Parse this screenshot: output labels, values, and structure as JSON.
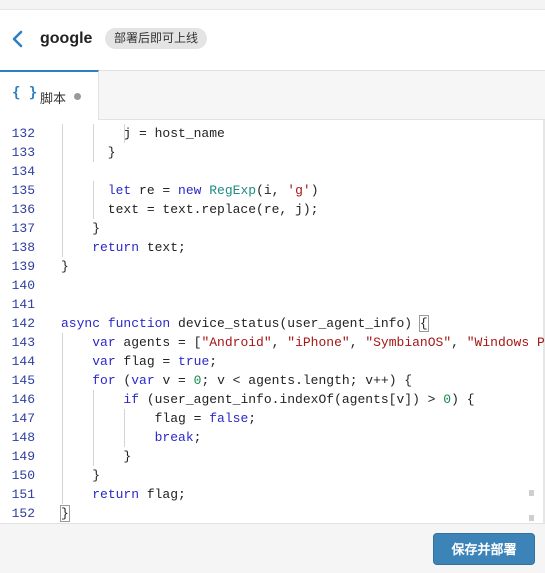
{
  "header": {
    "title": "google",
    "badge": "部署后即可上线"
  },
  "tabs": [
    {
      "icon": "{ }",
      "label": "脚本",
      "unsaved": true
    }
  ],
  "editor": {
    "lines": [
      {
        "num": "132",
        "code": "        j = host_name"
      },
      {
        "num": "133",
        "code": "      }"
      },
      {
        "num": "134",
        "code": ""
      },
      {
        "num": "135",
        "code": "      let re = new RegExp(i, 'g')"
      },
      {
        "num": "136",
        "code": "      text = text.replace(re, j);"
      },
      {
        "num": "137",
        "code": "    }"
      },
      {
        "num": "138",
        "code": "    return text;"
      },
      {
        "num": "139",
        "code": "}"
      },
      {
        "num": "140",
        "code": ""
      },
      {
        "num": "141",
        "code": ""
      },
      {
        "num": "142",
        "code": "async function device_status(user_agent_info) {"
      },
      {
        "num": "143",
        "code": "    var agents = [\"Android\", \"iPhone\", \"SymbianOS\", \"Windows Phone\""
      },
      {
        "num": "144",
        "code": "    var flag = true;"
      },
      {
        "num": "145",
        "code": "    for (var v = 0; v < agents.length; v++) {"
      },
      {
        "num": "146",
        "code": "        if (user_agent_info.indexOf(agents[v]) > 0) {"
      },
      {
        "num": "147",
        "code": "            flag = false;"
      },
      {
        "num": "148",
        "code": "            break;"
      },
      {
        "num": "149",
        "code": "        }"
      },
      {
        "num": "150",
        "code": "    }"
      },
      {
        "num": "151",
        "code": "    return flag;"
      },
      {
        "num": "152",
        "code": "}"
      }
    ]
  },
  "footer": {
    "save_label": "保存并部署"
  },
  "colors": {
    "accent": "#3c84b8",
    "keyword": "#2a28c9",
    "string": "#a61616",
    "number": "#14894a",
    "class": "#1f8a86",
    "line_number": "#2d3ea0"
  }
}
